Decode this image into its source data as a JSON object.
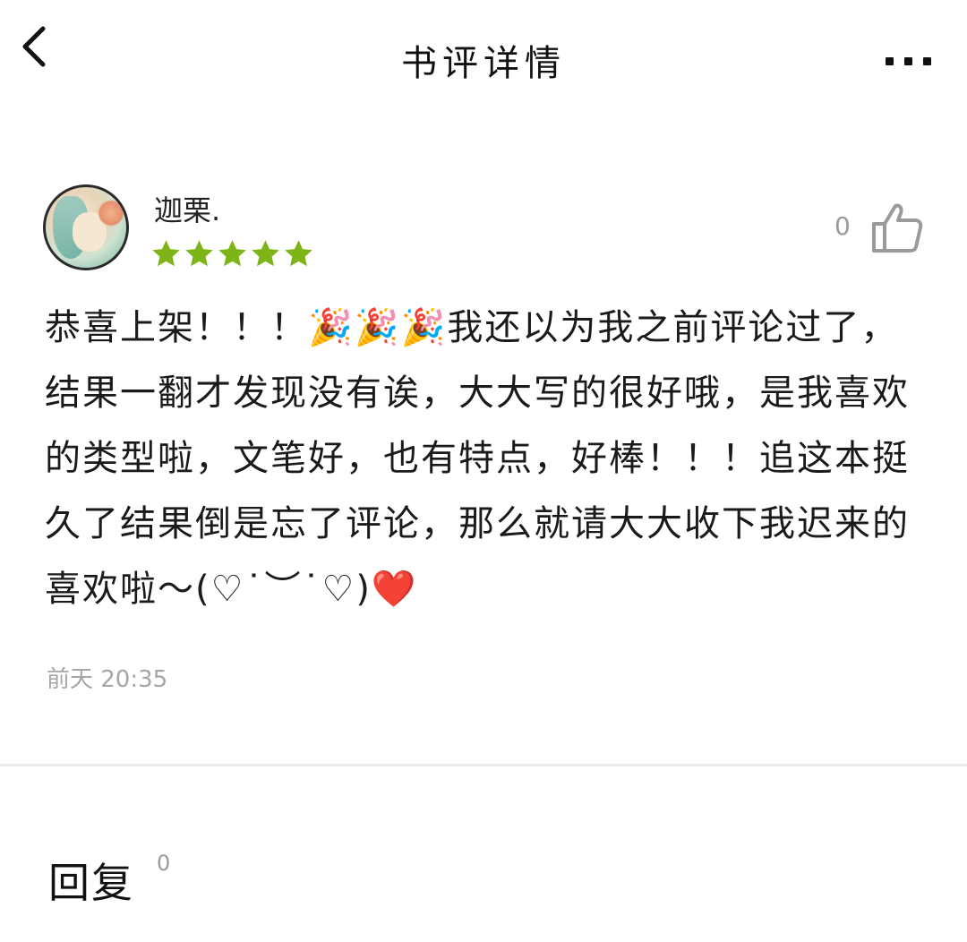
{
  "header": {
    "title": "书评详情"
  },
  "review": {
    "username": "迦栗.",
    "rating": 5,
    "like_count": "0",
    "text": "恭喜上架！！！🎉🎉🎉我还以为我之前评论过了，结果一翻才发现没有诶，大大写的很好哦，是我喜欢的类型啦，文笔好，也有特点，好棒！！！追这本挺久了结果倒是忘了评论，那么就请大大收下我迟来的喜欢啦～(♡˙︶˙♡)❤️",
    "time": "前天 20:35"
  },
  "replies": {
    "title": "回复",
    "count": "0"
  },
  "colors": {
    "star": "#7db518",
    "muted": "#a6a6a6",
    "divider": "#ececec"
  },
  "icons": [
    "back-icon",
    "more-icon",
    "thumbs-up-icon",
    "star-icon"
  ]
}
